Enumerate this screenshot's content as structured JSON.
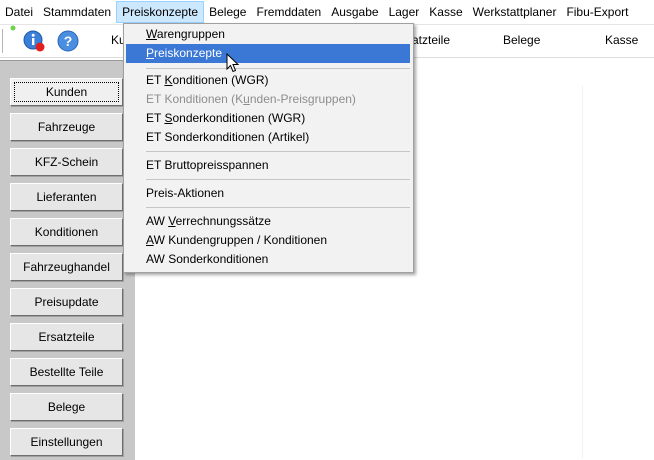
{
  "menubar": {
    "items": [
      {
        "label": "Datei"
      },
      {
        "label": "Stammdaten"
      },
      {
        "label": "Preiskonzepte"
      },
      {
        "label": "Belege"
      },
      {
        "label": "Fremddaten"
      },
      {
        "label": "Ausgabe"
      },
      {
        "label": "Lager"
      },
      {
        "label": "Kasse"
      },
      {
        "label": "Werkstattplaner"
      },
      {
        "label": "Fibu-Export"
      }
    ]
  },
  "toolbar": {
    "icons": [
      "info-icon",
      "help-icon"
    ],
    "labels": [
      "Ku",
      "atzteile",
      "Belege",
      "Kasse"
    ]
  },
  "sidebar": {
    "buttons": [
      {
        "label": "Kunden"
      },
      {
        "label": "Fahrzeuge"
      },
      {
        "label": "KFZ-Schein"
      },
      {
        "label": "Lieferanten"
      },
      {
        "label": "Konditionen"
      },
      {
        "label": "Fahrzeughandel"
      },
      {
        "label": "Preisupdate"
      },
      {
        "label": "Ersatzteile"
      },
      {
        "label": "Bestellte Teile"
      },
      {
        "label": "Belege"
      },
      {
        "label": "Einstellungen"
      }
    ]
  },
  "dropdown": {
    "items": [
      {
        "pre": "",
        "u": "W",
        "post": "arengruppen"
      },
      {
        "pre": "",
        "u": "P",
        "post": "reiskonzepte"
      },
      {
        "pre": "ET ",
        "u": "K",
        "post": "onditionen (WGR)"
      },
      {
        "pre": "ET Konditionen (K",
        "u": "u",
        "post": "nden-Preisgruppen)"
      },
      {
        "pre": "ET ",
        "u": "S",
        "post": "onderkonditionen (WGR)"
      },
      {
        "pre": "ET Sonderkonditionen (Artikel)",
        "u": "",
        "post": ""
      },
      {
        "pre": "ET Bruttopreisspannen",
        "u": "",
        "post": ""
      },
      {
        "pre": "Preis-Aktionen",
        "u": "",
        "post": ""
      },
      {
        "pre": "AW ",
        "u": "V",
        "post": "errechnungssätze"
      },
      {
        "pre": "",
        "u": "A",
        "post": "W Kundengruppen / Konditionen"
      },
      {
        "pre": "AW Sonderkonditionen",
        "u": "",
        "post": ""
      }
    ]
  },
  "colors": {
    "menu_open_bg": "#cce8ff",
    "highlight": "#3b78d6",
    "sidebar_bg": "#c8c8c8",
    "button_face": "#e6e6e6"
  }
}
